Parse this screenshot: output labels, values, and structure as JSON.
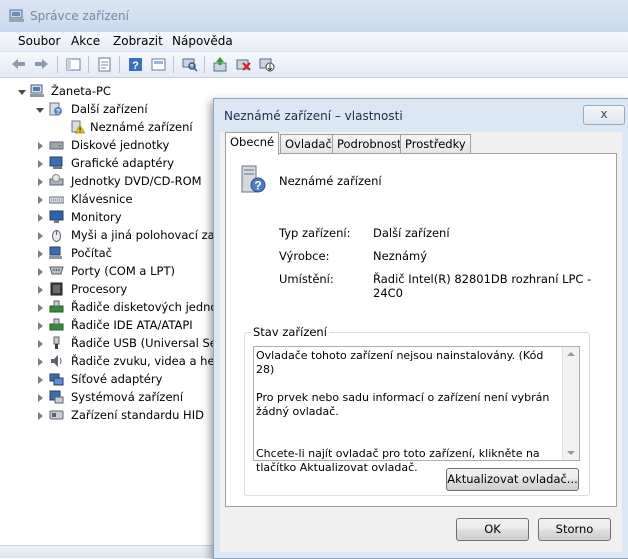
{
  "window": {
    "title": "Správce zařízení"
  },
  "menu": [
    "Soubor",
    "Akce",
    "Zobrazit",
    "Nápověda"
  ],
  "toolbar": [
    "back-icon",
    "forward-icon",
    "show-hide-tree-icon",
    "properties-icon",
    "help-icon",
    "view-icon",
    "scan-hardware-icon",
    "update-driver-icon",
    "uninstall-icon",
    "disable-icon"
  ],
  "tree": {
    "root": "Žaneta-PC",
    "other_devices": "Další zařízení",
    "unknown_device": "Neznámé zařízení",
    "categories": [
      "Diskové jednotky",
      "Grafické adaptéry",
      "Jednotky DVD/CD-ROM",
      "Klávesnice",
      "Monitory",
      "Myši a jiná polohovací zaří",
      "Počítač",
      "Porty (COM a LPT)",
      "Procesory",
      "Řadiče disketových jednotek",
      "Řadiče IDE ATA/ATAPI",
      "Řadiče USB (Universal Serial Bus)",
      "Řadiče zvuku, videa a her",
      "Síťové adaptéry",
      "Systémová zařízení",
      "Zařízení standardu HID"
    ]
  },
  "dialog": {
    "title": "Neznámé zařízení – vlastnosti",
    "close": "x",
    "tabs": [
      "Obecné",
      "Ovladač",
      "Podrobnosti",
      "Prostředky"
    ],
    "active_tab": "Obecné",
    "device_name": "Neznámé zařízení",
    "type_label": "Typ zařízení:",
    "type_value": "Další zařízení",
    "manufacturer_label": "Výrobce:",
    "manufacturer_value": "Neznámý",
    "location_label": "Umístění:",
    "location_value": "Řadič Intel(R) 82801DB rozhraní LPC - 24C0",
    "status_group": "Stav zařízení",
    "status_text": "Ovladače tohoto zařízení nejsou nainstalovány. (Kód 28)\n\nPro prvek nebo sadu informací o zařízení není vybrán žádný ovladač.\n\n\nChcete-li najít ovladač pro toto zařízení, klikněte na tlačítko Aktualizovat ovladač.",
    "update_button": "Aktualizovat ovladač...",
    "ok_button": "OK",
    "cancel_button": "Storno"
  }
}
